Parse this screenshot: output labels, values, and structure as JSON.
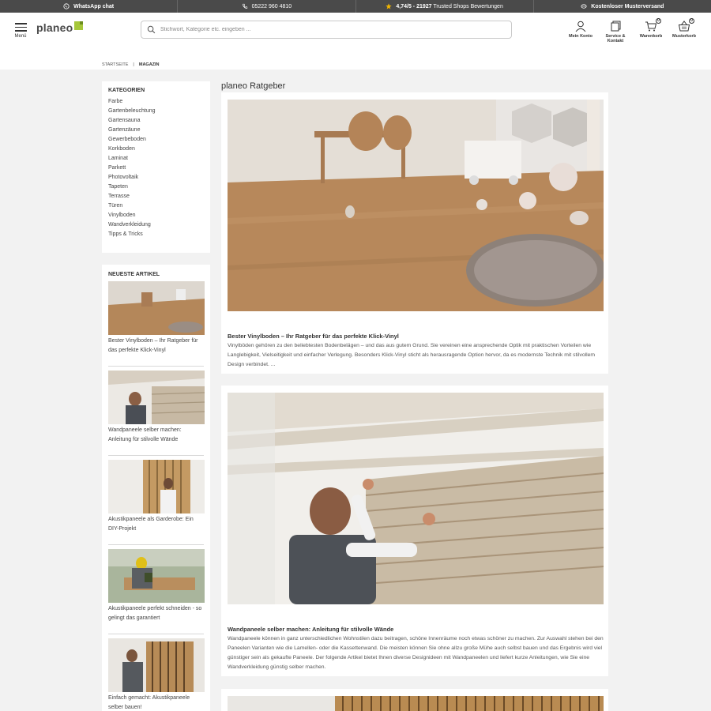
{
  "topbar": {
    "whatsapp": "WhatsApp chat",
    "phone": "05222 960 4810",
    "rating_bold": "4,74/5 - 21927",
    "rating_rest": "Trusted Shops Bewertungen",
    "shipping": "Kostenloser Musterversand"
  },
  "header": {
    "menu_label": "Menü",
    "logo_text": "planeo",
    "search_placeholder": "Stichwort, Kategorie etc. eingeben ...",
    "account_label": "Mein Konto",
    "service_label": "Service & Kontakt",
    "cart_label": "Warenkorb",
    "cart_count": "0",
    "sample_label": "Musterkorb",
    "sample_count": "0"
  },
  "breadcrumb": {
    "home": "STARTSEITE",
    "sep": "|",
    "current": "MAGAZIN"
  },
  "categories": {
    "title": "KATEGORIEN",
    "items": [
      "Farbe",
      "Gartenbeleuchtung",
      "Gartensauna",
      "Gartenzäune",
      "Gewerbeboden",
      "Korkboden",
      "Laminat",
      "Parkett",
      "Photovoltaik",
      "Tapeten",
      "Terrasse",
      "Türen",
      "Vinylboden",
      "Wandverkleidung",
      "Tipps & Tricks"
    ]
  },
  "newest": {
    "title": "NEUESTE ARTIKEL",
    "items": [
      {
        "title": "Bester Vinylboden – Ihr Ratgeber für das perfekte Klick-Vinyl"
      },
      {
        "title": "Wandpaneele selber machen: Anleitung für stilvolle Wände"
      },
      {
        "title": "Akustikpaneele als Garderobe: Ein DIY-Projekt"
      },
      {
        "title": "Akustikpaneele perfekt schneiden - so gelingt das garantiert"
      },
      {
        "title": "Einfach gemacht: Akustikpaneele selber bauen!"
      }
    ]
  },
  "main": {
    "title": "planeo Ratgeber",
    "articles": [
      {
        "title": "Bester Vinylboden – Ihr Ratgeber für das perfekte Klick-Vinyl",
        "text": "Vinylböden gehören zu den beliebtesten Bodenbelägen – und das aus gutem Grund. Sie vereinen eine ansprechende Optik mit praktischen Vorteilen wie Langlebigkeit, Vielseitigkeit und einfacher Verlegung. Besonders Klick-Vinyl sticht als herausragende Option hervor, da es modernste Technik mit stilvollem Design verbindet. ..."
      },
      {
        "title": "Wandpaneele selber machen: Anleitung für stilvolle Wände",
        "text": "Wandpaneele können in ganz unterschiedlichen Wohnstilen dazu beitragen, schöne Innenräume noch etwas schöner zu machen. Zur Auswahl stehen bei den Paneelen Varianten wie die Lamellen- oder die Kassettenwand. Die meisten können Sie ohne allzu große Mühe auch selbst bauen und das Ergebnis wird viel günstiger sein als gekaufte Paneele. Der folgende Artikel bietet Ihnen diverse Designideen mit Wandpaneelen und liefert kurze Anleitungen, wie Sie eine Wandverkleidung günstig selber machen."
      }
    ]
  },
  "colors": {
    "topbar": "#4a4a4a",
    "brand_green": "#a6c73a",
    "page_bg": "#f2f2f2",
    "star": "#f0b400"
  }
}
